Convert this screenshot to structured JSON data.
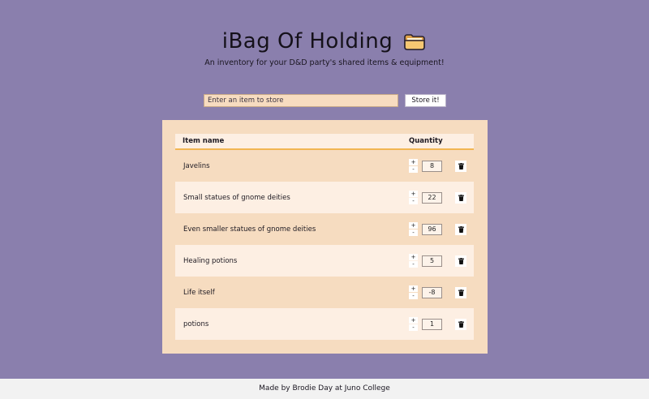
{
  "header": {
    "title": "iBag Of Holding",
    "subtitle": "An inventory for your D&D party's shared items & equipment!",
    "icon": "folder-icon"
  },
  "add_form": {
    "placeholder": "Enter an item to store",
    "value": "",
    "submit_label": "Store it!"
  },
  "table": {
    "headers": {
      "name": "Item name",
      "quantity": "Quantity"
    },
    "rows": [
      {
        "name": "Javelins",
        "quantity": "8"
      },
      {
        "name": "Small statues of gnome deities",
        "quantity": "22"
      },
      {
        "name": "Even smaller statues of gnome deities",
        "quantity": "96"
      },
      {
        "name": "Healing potions",
        "quantity": "5"
      },
      {
        "name": "Life itself",
        "quantity": "-8"
      },
      {
        "name": "potions",
        "quantity": "1"
      }
    ],
    "increment_label": "+",
    "decrement_label": "-",
    "delete_icon": "trash-icon"
  },
  "footer": {
    "text": "Made by Brodie Day at Juno College"
  },
  "colors": {
    "background": "#8a7fad",
    "panel": "#f6dcc0",
    "row_alt": "#fdefe3",
    "accent": "#f2b552",
    "footer": "#f2f2f2"
  }
}
